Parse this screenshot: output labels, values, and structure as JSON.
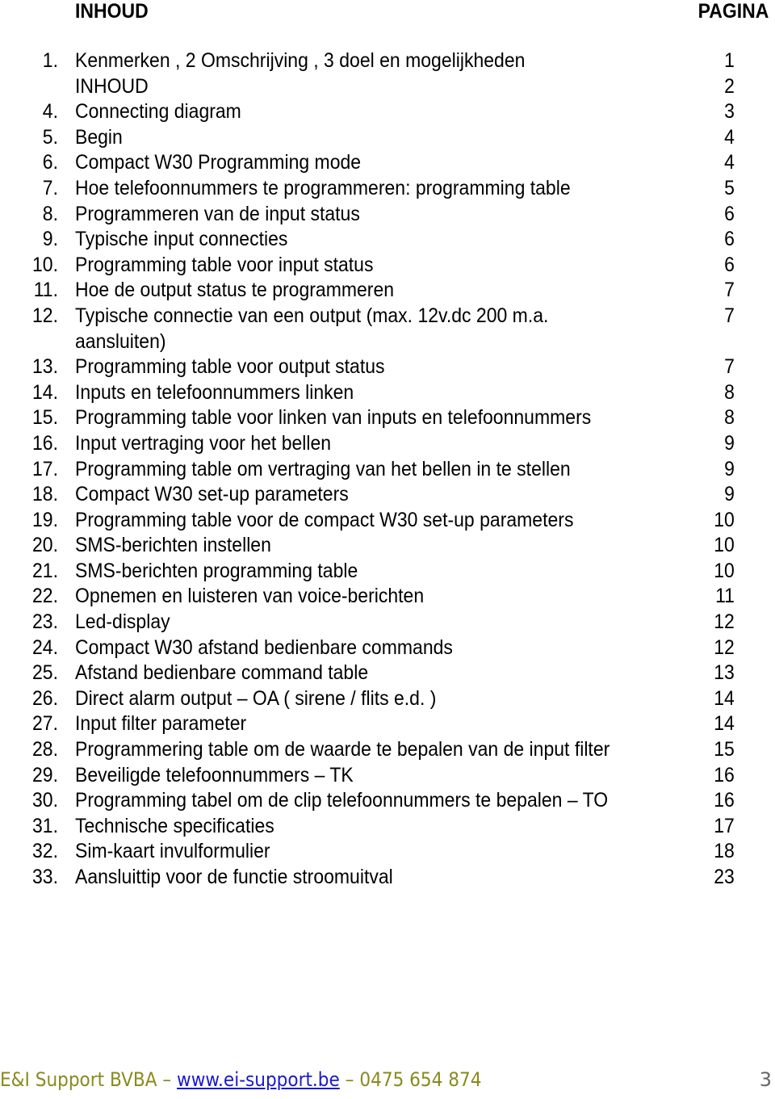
{
  "header": {
    "title": "INHOUD",
    "page_label": "PAGINA"
  },
  "toc": [
    {
      "num": "1.",
      "text": "Kenmerken  , 2 Omschrijving , 3 doel en mogelijkheden",
      "page": "1"
    },
    {
      "num": "",
      "text": "INHOUD",
      "page": "2"
    },
    {
      "num": "4.",
      "text": "Connecting diagram",
      "page": "3"
    },
    {
      "num": "5.",
      "text": "Begin",
      "page": "4"
    },
    {
      "num": "6.",
      "text": "Compact W30 Programming mode",
      "page": "4"
    },
    {
      "num": "7.",
      "text": "Hoe telefoonnummers te programmeren: programming table",
      "page": "5"
    },
    {
      "num": "8.",
      "text": "Programmeren van de input status",
      "page": "6"
    },
    {
      "num": "9.",
      "text": "Typische input connecties",
      "page": "6"
    },
    {
      "num": "10.",
      "text": "Programming table voor input status",
      "page": "6"
    },
    {
      "num": "11.",
      "text": "Hoe de output status te programmeren",
      "page": "7"
    },
    {
      "num": "12.",
      "text": "Typische connectie van een output (max. 12v.dc 200 m.a. aansluiten)",
      "page": "7"
    },
    {
      "num": "13.",
      "text": "Programming table voor output status",
      "page": "7"
    },
    {
      "num": "14.",
      "text": "Inputs en telefoonnummers linken",
      "page": "8"
    },
    {
      "num": "15.",
      "text": "Programming table voor linken van inputs en telefoonnummers",
      "page": "8"
    },
    {
      "num": "16.",
      "text": "Input vertraging voor het bellen",
      "page": "9"
    },
    {
      "num": "17.",
      "text": "Programming table om vertraging van het bellen in te stellen",
      "page": "9",
      "justify": true
    },
    {
      "num": "18.",
      "text": "Compact W30 set-up parameters",
      "page": "9"
    },
    {
      "num": "19.",
      "text": "Programming table voor de compact W30 set-up parameters",
      "page": "10",
      "justify": true
    },
    {
      "num": "20.",
      "text": "SMS-berichten instellen",
      "page": "10"
    },
    {
      "num": "21.",
      "text": "SMS-berichten programming table",
      "page": "10"
    },
    {
      "num": "22.",
      "text": "Opnemen en luisteren van voice-berichten",
      "page": "11"
    },
    {
      "num": "23.",
      "text": "Led-display",
      "page": "12"
    },
    {
      "num": "24.",
      "text": "Compact W30 afstand bedienbare commands",
      "page": "12"
    },
    {
      "num": "25.",
      "text": "Afstand bedienbare command table",
      "page": "13"
    },
    {
      "num": "26.",
      "text": "Direct alarm output – OA  ( sirene / flits   e.d. )",
      "page": "14"
    },
    {
      "num": "27.",
      "text": "Input filter parameter",
      "page": "14"
    },
    {
      "num": "28.",
      "text": "Programmering table om de waarde te bepalen van de input filter",
      "page": "15",
      "justify": true
    },
    {
      "num": "29.",
      "text": "Beveiligde telefoonnummers – TK",
      "page": "16"
    },
    {
      "num": "30.",
      "text": "Programming tabel om de clip telefoonnummers te bepalen – TO",
      "page": "16",
      "justify": true
    },
    {
      "num": "31.",
      "text": "Technische specificaties",
      "page": "17"
    },
    {
      "num": "32.",
      "text": "Sim-kaart invulformulier",
      "page": "18"
    },
    {
      "num": "33.",
      "text": "Aansluittip voor de functie stroomuitval",
      "page": "23"
    }
  ],
  "footer": {
    "company": "E&I Support BVBA – ",
    "website": "www.ei-support.be",
    "phone": " – 0475 654 874",
    "page_number": "3",
    "text_color": "#8a8a1e",
    "link_color": "#1a1acc"
  }
}
